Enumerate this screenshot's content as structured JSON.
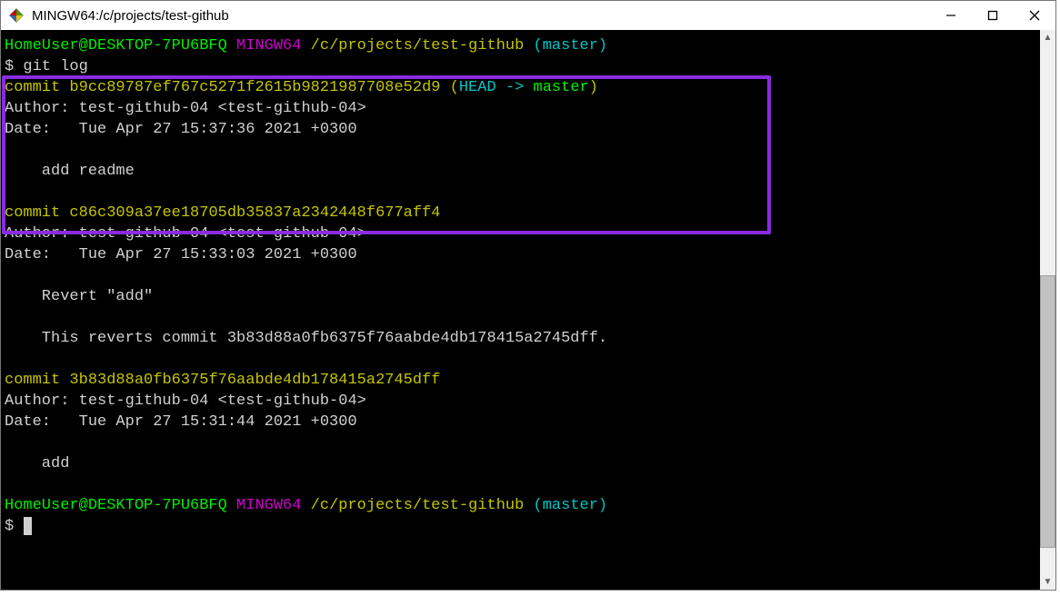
{
  "window": {
    "title": "MINGW64:/c/projects/test-github"
  },
  "colors": {
    "green": "#00f000",
    "yellow": "#c5c500",
    "purple": "#d000d0",
    "cyan": "#00c5c5",
    "text": "#d0d0d0",
    "highlight_border": "#8a2be2"
  },
  "prompt": {
    "user_host": "HomeUser@DESKTOP-7PU6BFQ",
    "env": "MINGW64",
    "cwd": "/c/projects/test-github",
    "branch": "(master)",
    "dollar": "$"
  },
  "terminal": {
    "command": "git log",
    "commits": [
      {
        "hash_line_prefix": "commit ",
        "hash": "b9cc89787ef767c5271f2615b9821987708e52d9",
        "refs_open": " (",
        "refs_head": "HEAD -> ",
        "refs_branch": "master",
        "refs_close": ")",
        "author_line": "Author: test-github-04 <test-github-04>",
        "date_line": "Date:   Tue Apr 27 15:37:36 2021 +0300",
        "message": "    add readme"
      },
      {
        "hash_line_prefix": "commit ",
        "hash": "c86c309a37ee18705db35837a2342448f677aff4",
        "author_line": "Author: test-github-04 <test-github-04>",
        "date_line": "Date:   Tue Apr 27 15:33:03 2021 +0300",
        "message": "    Revert \"add\"",
        "message2": "    This reverts commit 3b83d88a0fb6375f76aabde4db178415a2745dff."
      },
      {
        "hash_line_prefix": "commit ",
        "hash": "3b83d88a0fb6375f76aabde4db178415a2745dff",
        "author_line": "Author: test-github-04 <test-github-04>",
        "date_line": "Date:   Tue Apr 27 15:31:44 2021 +0300",
        "message": "    add"
      }
    ]
  }
}
